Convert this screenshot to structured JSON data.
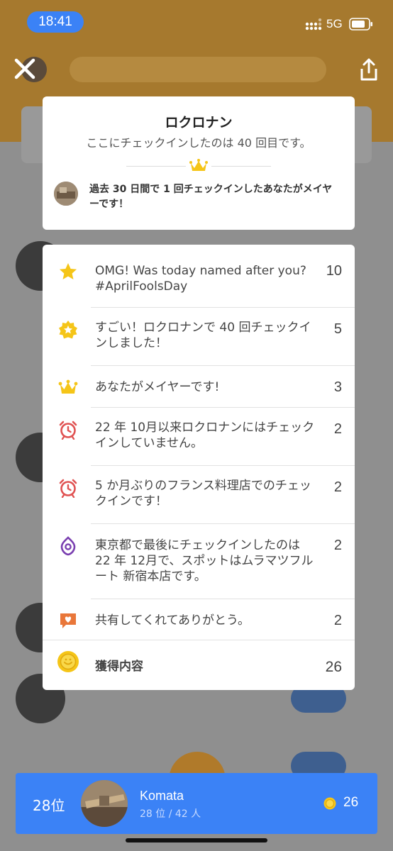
{
  "status_bar": {
    "time": "18:41",
    "network": "5G"
  },
  "venue": {
    "name": "ロクロナン",
    "checkin_count_text": "ここにチェックインしたのは 40 回目です。",
    "mayor_message": "過去 30 日間で 1 回チェックインしたあなたがメイヤーです！"
  },
  "points": [
    {
      "icon": "star-icon",
      "text": "OMG! Was today named after you? #AprilFoolsDay",
      "value": "10"
    },
    {
      "icon": "badge-star-icon",
      "text": "すごい！ロクロナンで 40 回チェックインしました！",
      "value": "5"
    },
    {
      "icon": "crown-icon",
      "text": "あなたがメイヤーです!",
      "value": "3"
    },
    {
      "icon": "alarm-clock-icon",
      "text": "22 年 10月以来ロクロナンにはチェックインしていません。",
      "value": "2"
    },
    {
      "icon": "alarm-clock-icon",
      "text": "5 か月ぶりのフランス料理店でのチェックインです！",
      "value": "2"
    },
    {
      "icon": "location-pin-icon",
      "text": "東京都で最後にチェックインしたのは 22 年 12月で、スポットはムラマツフルート 新宿本店です。",
      "value": "2"
    },
    {
      "icon": "heart-speech-icon",
      "text": "共有してくれてありがとう。",
      "value": "2"
    }
  ],
  "total": {
    "label": "獲得内容",
    "value": "26"
  },
  "bottom_bar": {
    "rank": "28位",
    "user_name": "Komata",
    "user_sub": "28 位 / 42 人",
    "coins": "26"
  },
  "colors": {
    "accent_blue": "#3b82f6",
    "gold": "#f5c518",
    "alarm_red": "#e05252",
    "pin_purple": "#7a3fb0",
    "heart_orange": "#e9773a"
  }
}
